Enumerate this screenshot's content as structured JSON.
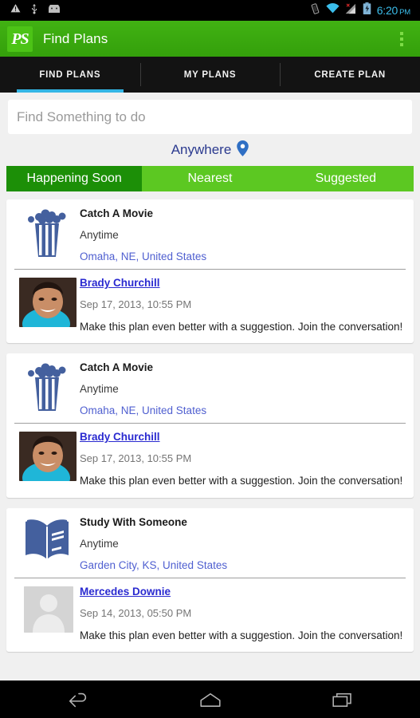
{
  "status_bar": {
    "icons": [
      "warning-triangle-icon",
      "usb-icon",
      "android-robot-icon"
    ],
    "right_icons": [
      "vibrate-icon",
      "wifi-icon",
      "cellular-signal-icon",
      "battery-charging-icon"
    ],
    "time": "6:20",
    "meridiem": "PM"
  },
  "action_bar": {
    "logo_text": "PS",
    "title": "Find Plans",
    "overflow_label": "More options"
  },
  "tabs": [
    {
      "label": "FIND PLANS",
      "active": true
    },
    {
      "label": "MY PLANS",
      "active": false
    },
    {
      "label": "CREATE PLAN",
      "active": false
    }
  ],
  "search": {
    "value": "",
    "placeholder": "Find Something to do"
  },
  "location": {
    "label": "Anywhere",
    "icon": "map-pin-icon"
  },
  "filters": [
    {
      "label": "Happening Soon",
      "selected": true
    },
    {
      "label": "Nearest",
      "selected": false
    },
    {
      "label": "Suggested",
      "selected": false
    }
  ],
  "colors": {
    "brand_green": "#3aa80f",
    "filter_green": "#5cc822",
    "filter_green_selected": "#1c8f07",
    "tab_accent": "#33b5e5",
    "link_blue": "#4f5fd0",
    "author_blue": "#2a2ad0",
    "icon_blue": "#44609e",
    "page_bg": "#f0f0f0"
  },
  "plans": [
    {
      "icon": "popcorn-icon",
      "title": "Catch A Movie",
      "when": "Anytime",
      "where": "Omaha, NE, United States",
      "comment": {
        "avatar": "photo-avatar",
        "author": "Brady Churchill",
        "time": "Sep 17, 2013, 10:55 PM",
        "text": "Make this plan even better with a suggestion. Join the conversation!"
      }
    },
    {
      "icon": "popcorn-icon",
      "title": "Catch A Movie",
      "when": "Anytime",
      "where": "Omaha, NE, United States",
      "comment": {
        "avatar": "photo-avatar",
        "author": "Brady Churchill",
        "time": "Sep 17, 2013, 10:55 PM",
        "text": "Make this plan even better with a suggestion. Join the conversation!"
      }
    },
    {
      "icon": "book-icon",
      "title": "Study With Someone",
      "when": "Anytime",
      "where": "Garden City, KS, United States",
      "comment": {
        "avatar": "placeholder-avatar",
        "author": "Mercedes Downie",
        "time": "Sep 14, 2013, 05:50 PM",
        "text": "Make this plan even better with a suggestion. Join the conversation!"
      }
    }
  ],
  "nav_bar": {
    "back_label": "Back",
    "home_label": "Home",
    "recents_label": "Recent apps"
  }
}
